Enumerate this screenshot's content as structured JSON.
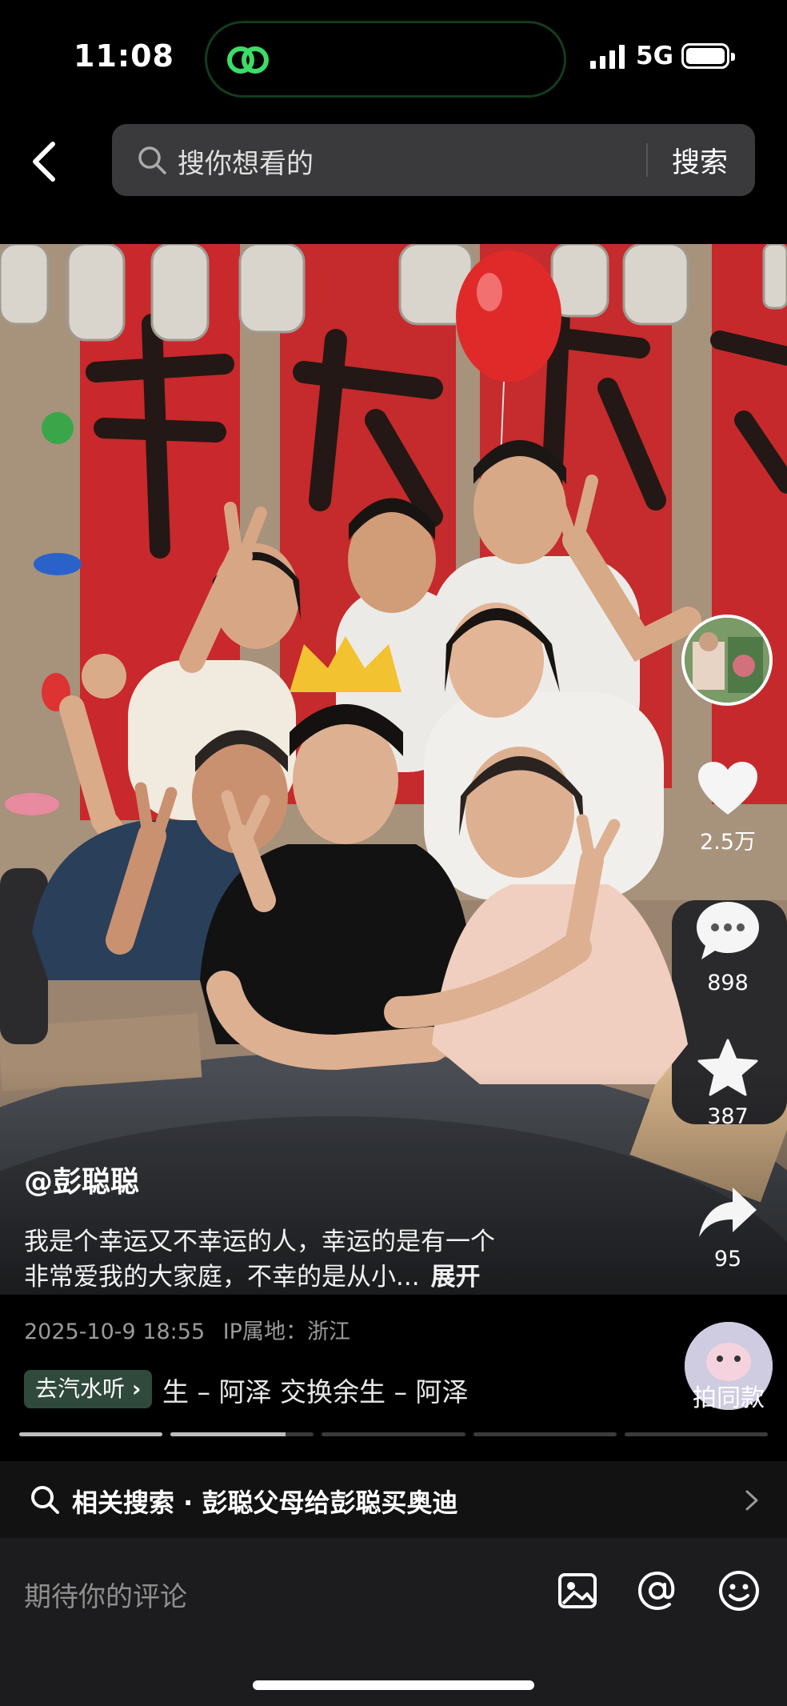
{
  "status_bar": {
    "time": "11:08",
    "network": "5G"
  },
  "search": {
    "placeholder": "搜你想看的",
    "button": "搜索"
  },
  "actions": {
    "like_count": "2.5万",
    "comment_count": "898",
    "favorite_count": "387",
    "share_count": "95"
  },
  "post": {
    "author": "@彭聪聪",
    "caption_line1": "我是个幸运又不幸运的人，幸运的是有一个",
    "caption_line2": "非常爱我的大家庭，不幸的是从小...",
    "expand_label": "展开",
    "date": "2025-10-9 18:55",
    "ip_location": "IP属地：浙江"
  },
  "music": {
    "pill_label": "去汽水听",
    "track_text": "生 – 阿泽   交换余生 – 阿泽"
  },
  "same_style_label": "拍同款",
  "progress": {
    "segments": 5,
    "active_index": 1,
    "active_fraction": 0.8
  },
  "related": {
    "text": "相关搜索 · 彭聪父母给彭聪买奥迪"
  },
  "comment": {
    "placeholder": "期待你的评论"
  },
  "icons": [
    "back-icon",
    "search-icon",
    "heart-icon",
    "comment-bubble-icon",
    "star-icon",
    "share-icon",
    "image-icon",
    "at-icon",
    "emoji-icon",
    "chevron-right-icon"
  ]
}
